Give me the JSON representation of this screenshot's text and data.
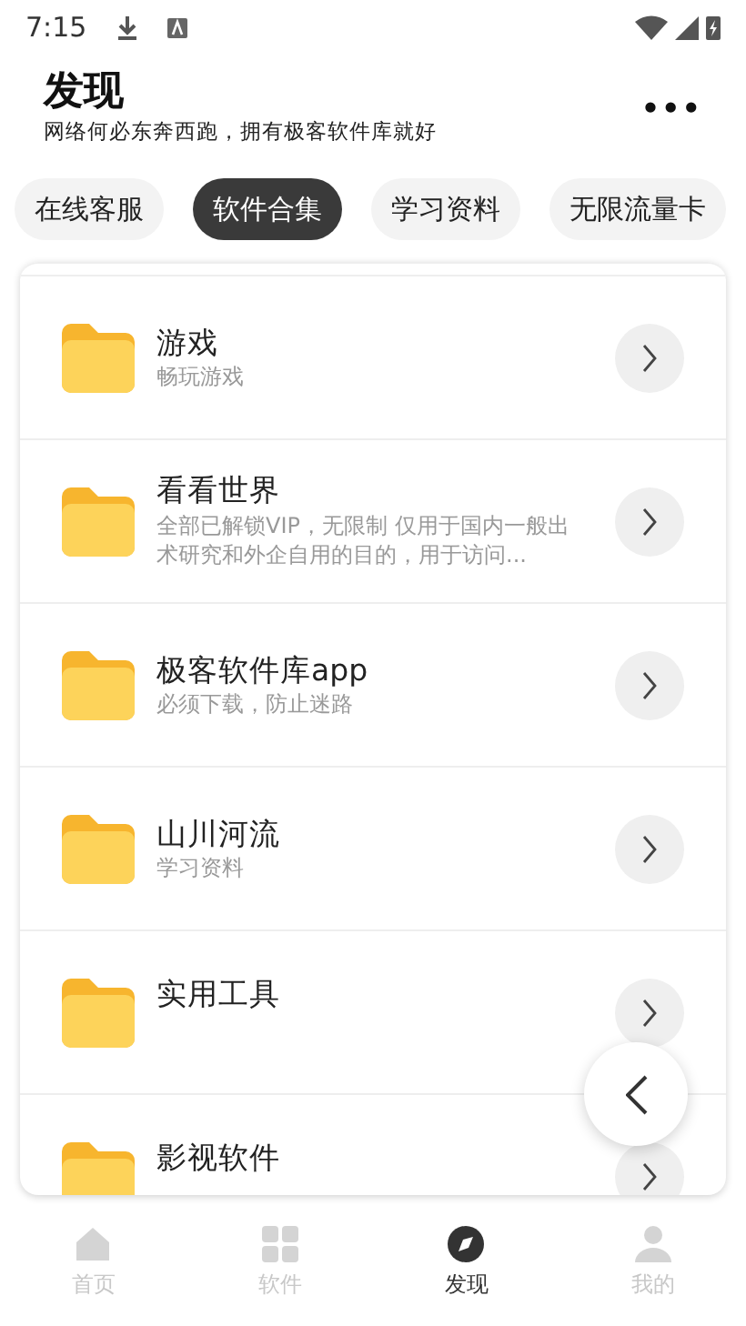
{
  "status_bar": {
    "time": "7:15"
  },
  "header": {
    "title": "发现",
    "subtitle": "网络何必东奔西跑，拥有极客软件库就好",
    "menu": "•••"
  },
  "chips": [
    {
      "label": "在线客服",
      "selected": false
    },
    {
      "label": "软件合集",
      "selected": true
    },
    {
      "label": "学习资料",
      "selected": false
    },
    {
      "label": "无限流量卡",
      "selected": false
    }
  ],
  "items": [
    {
      "title": "游戏",
      "subtitle": "畅玩游戏"
    },
    {
      "title": "看看世界",
      "subtitle": "全部已解锁VIP，无限制 仅用于国内一般出术研究和外企自用的目的，用于访问..."
    },
    {
      "title": "极客软件库app",
      "subtitle": "必须下载，防止迷路"
    },
    {
      "title": "山川河流",
      "subtitle": "学习资料"
    },
    {
      "title": "实用工具"
    },
    {
      "title": "影视软件"
    }
  ],
  "bottom_nav": [
    {
      "label": "首页",
      "kind": "home",
      "selected": false
    },
    {
      "label": "软件",
      "kind": "grid",
      "selected": false
    },
    {
      "label": "发现",
      "kind": "compass",
      "selected": true
    },
    {
      "label": "我的",
      "kind": "person",
      "selected": false
    }
  ]
}
